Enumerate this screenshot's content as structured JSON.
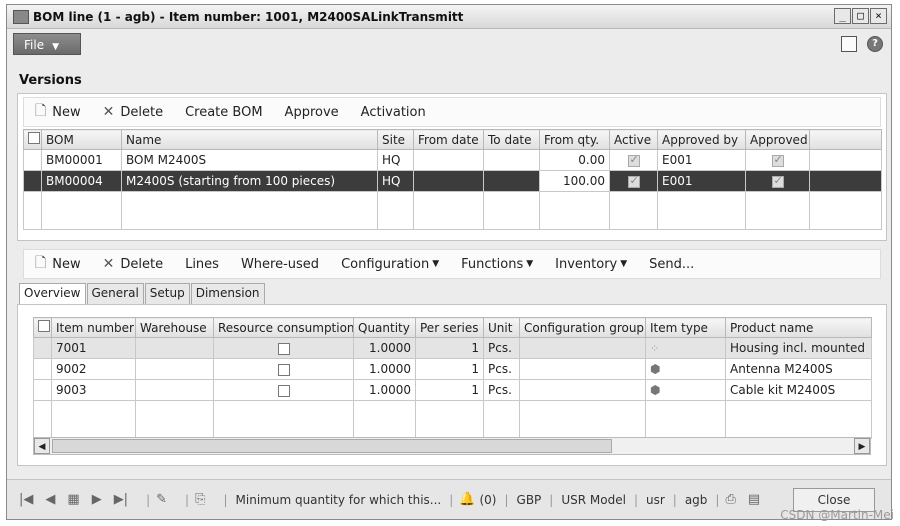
{
  "window": {
    "title": "BOM line (1 - agb) - Item number: 1001, M2400SALinkTransmitt"
  },
  "menubar": {
    "file_label": "File"
  },
  "versions": {
    "section_title": "Versions",
    "toolbar": {
      "new": "New",
      "delete": "Delete",
      "create_bom": "Create BOM",
      "approve": "Approve",
      "activation": "Activation"
    },
    "columns": [
      "BOM",
      "Name",
      "Site",
      "From date",
      "To date",
      "From qty.",
      "Active",
      "Approved by",
      "Approved"
    ],
    "rows": [
      {
        "bom": "BM00001",
        "name": "BOM M2400S",
        "site": "HQ",
        "from_date": "",
        "to_date": "",
        "from_qty": "0.00",
        "active": true,
        "approved_by": "E001",
        "approved": true
      },
      {
        "bom": "BM00004",
        "name": "M2400S (starting from 100 pieces)",
        "site": "HQ",
        "from_date": "",
        "to_date": "",
        "from_qty": "100.00",
        "active": true,
        "approved_by": "E001",
        "approved": true
      }
    ]
  },
  "lines": {
    "toolbar": {
      "new": "New",
      "delete": "Delete",
      "lines": "Lines",
      "where_used": "Where-used",
      "configuration": "Configuration",
      "functions": "Functions",
      "inventory": "Inventory",
      "send": "Send..."
    },
    "tabs": [
      "Overview",
      "General",
      "Setup",
      "Dimension"
    ],
    "columns": [
      "Item number",
      "Warehouse",
      "Resource consumption",
      "Quantity",
      "Per series",
      "Unit",
      "Configuration group",
      "Item type",
      "Product name"
    ],
    "rows": [
      {
        "item_number": "7001",
        "warehouse": "",
        "quantity": "1.0000",
        "per_series": "1",
        "unit": "Pcs.",
        "config_group": "",
        "item_type_icon": "bom-icon",
        "product_name": "Housing incl. mounted"
      },
      {
        "item_number": "9002",
        "warehouse": "",
        "quantity": "1.0000",
        "per_series": "1",
        "unit": "Pcs.",
        "config_group": "",
        "item_type_icon": "item-icon",
        "product_name": "Antenna M2400S"
      },
      {
        "item_number": "9003",
        "warehouse": "",
        "quantity": "1.0000",
        "per_series": "1",
        "unit": "Pcs.",
        "config_group": "",
        "item_type_icon": "item-icon",
        "product_name": "Cable kit M2400S"
      }
    ]
  },
  "statusbar": {
    "message": "Minimum quantity for which this...",
    "notifications": "(0)",
    "currency": "GBP",
    "model": "USR Model",
    "user": "usr",
    "company": "agb",
    "close_label": "Close"
  },
  "watermark": "CSDN @Martin-Mei"
}
